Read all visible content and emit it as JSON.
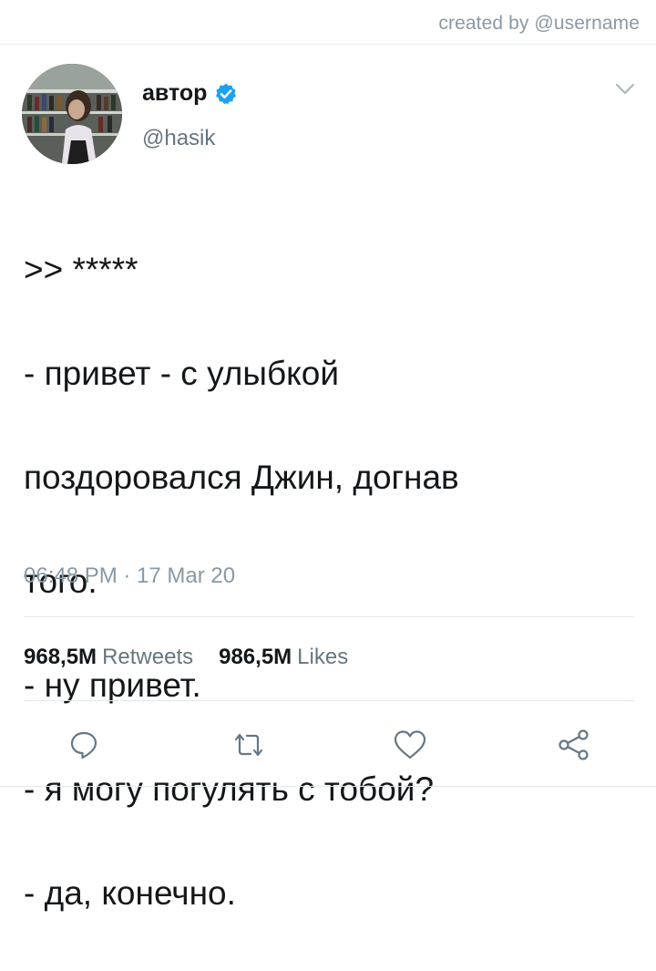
{
  "watermark": "created by @username",
  "author": {
    "name": "автор",
    "handle": "@hasik",
    "verified": true
  },
  "tweet": {
    "lines": [
      ">> *****",
      "- привет - с улыбкой",
      "поздоровался Джин, догнав",
      "того.",
      "- ну привет.",
      "- я могу погулять с тобой?",
      "- да, конечно."
    ],
    "timestamp": "06:48 PM · 17 Mar 20"
  },
  "stats": {
    "retweets_count": "968,5M",
    "retweets_label": "Retweets",
    "likes_count": "986,5M",
    "likes_label": "Likes"
  },
  "icons": {
    "reply": "reply-icon",
    "retweet": "retweet-icon",
    "like": "heart-icon",
    "share": "share-icon",
    "menu": "chevron-down-icon",
    "verified": "verified-badge-icon"
  },
  "colors": {
    "text": "#14171a",
    "secondary": "#66757f",
    "verified_blue": "#1da1f2",
    "icon_gray": "#657786"
  }
}
